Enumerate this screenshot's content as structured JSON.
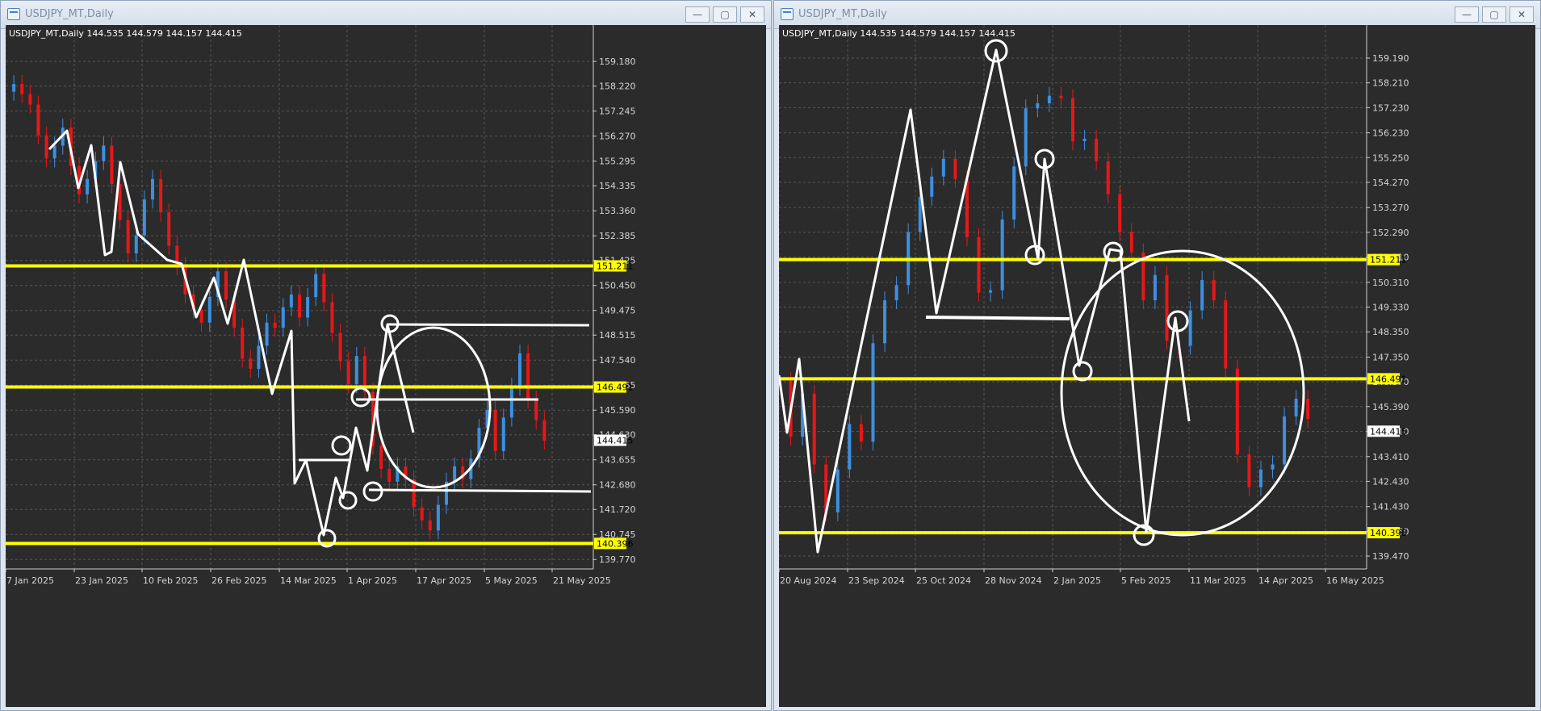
{
  "windows": [
    {
      "title": "USDJPY_MT,Daily",
      "controls": {
        "minimize": "—",
        "maximize": "▢",
        "close": "✕"
      },
      "chart_header": "USDJPY_MT,Daily  144.535 144.579 144.157 144.415"
    },
    {
      "title": "USDJPY_MT,Daily",
      "controls": {
        "minimize": "—",
        "maximize": "▢",
        "close": "✕"
      },
      "chart_header": "USDJPY_MT,Daily  144.535 144.579 144.157 144.415"
    }
  ],
  "colors": {
    "background": "#2b2b2b",
    "grid": "#555555",
    "up_candle": "#3d8fe0",
    "down_candle": "#e81717",
    "support_line": "#ffff00",
    "drawing": "#ffffff"
  },
  "chart_data": [
    {
      "type": "candlestick",
      "symbol": "USDJPY_MT",
      "timeframe": "Daily",
      "y_ticks": [
        159.18,
        158.22,
        157.245,
        156.27,
        155.295,
        154.335,
        153.36,
        152.385,
        151.425,
        150.45,
        149.475,
        148.515,
        147.54,
        146.565,
        145.59,
        144.63,
        143.655,
        142.68,
        141.72,
        140.745,
        139.77
      ],
      "x_ticks": [
        "7 Jan 2025",
        "23 Jan 2025",
        "10 Feb 2025",
        "26 Feb 2025",
        "14 Mar 2025",
        "1 Apr 2025",
        "17 Apr 2025",
        "5 May 2025",
        "21 May 2025"
      ],
      "ylim": [
        139.4,
        160.6
      ],
      "xlim": [
        "2025-01-07",
        "2025-05-31"
      ],
      "current_price": 144.415,
      "horizontal_levels": [
        151.211,
        146.491,
        140.396
      ],
      "close_series": [
        [
          "2025-01-07",
          158.0
        ],
        [
          "2025-01-09",
          158.3
        ],
        [
          "2025-01-11",
          157.9
        ],
        [
          "2025-01-13",
          157.5
        ],
        [
          "2025-01-15",
          156.3
        ],
        [
          "2025-01-17",
          155.4
        ],
        [
          "2025-01-19",
          155.9
        ],
        [
          "2025-01-21",
          156.6
        ],
        [
          "2025-01-23",
          155.1
        ],
        [
          "2025-01-25",
          154.0
        ],
        [
          "2025-01-27",
          154.6
        ],
        [
          "2025-01-29",
          155.3
        ],
        [
          "2025-01-31",
          155.9
        ],
        [
          "2025-02-02",
          154.4
        ],
        [
          "2025-02-04",
          153.0
        ],
        [
          "2025-02-06",
          151.7
        ],
        [
          "2025-02-08",
          152.4
        ],
        [
          "2025-02-10",
          153.8
        ],
        [
          "2025-02-12",
          154.6
        ],
        [
          "2025-02-14",
          153.3
        ],
        [
          "2025-02-16",
          152.0
        ],
        [
          "2025-02-18",
          151.2
        ],
        [
          "2025-02-20",
          150.1
        ],
        [
          "2025-02-22",
          149.5
        ],
        [
          "2025-02-24",
          149.0
        ],
        [
          "2025-02-26",
          150.0
        ],
        [
          "2025-02-28",
          151.0
        ],
        [
          "2025-03-02",
          149.9
        ],
        [
          "2025-03-04",
          148.8
        ],
        [
          "2025-03-06",
          147.6
        ],
        [
          "2025-03-08",
          147.2
        ],
        [
          "2025-03-10",
          148.1
        ],
        [
          "2025-03-12",
          149.0
        ],
        [
          "2025-03-14",
          148.8
        ],
        [
          "2025-03-16",
          149.6
        ],
        [
          "2025-03-18",
          150.1
        ],
        [
          "2025-03-20",
          149.2
        ],
        [
          "2025-03-22",
          150.0
        ],
        [
          "2025-03-24",
          150.9
        ],
        [
          "2025-03-26",
          149.8
        ],
        [
          "2025-03-28",
          148.6
        ],
        [
          "2025-03-30",
          147.5
        ],
        [
          "2025-04-01",
          146.6
        ],
        [
          "2025-04-03",
          147.7
        ],
        [
          "2025-04-05",
          146.3
        ],
        [
          "2025-04-07",
          144.2
        ],
        [
          "2025-04-09",
          143.3
        ],
        [
          "2025-04-11",
          142.8
        ],
        [
          "2025-04-13",
          143.4
        ],
        [
          "2025-04-15",
          142.9
        ],
        [
          "2025-04-17",
          141.8
        ],
        [
          "2025-04-19",
          141.3
        ],
        [
          "2025-04-21",
          140.9
        ],
        [
          "2025-04-23",
          141.9
        ],
        [
          "2025-04-25",
          142.8
        ],
        [
          "2025-04-27",
          143.4
        ],
        [
          "2025-04-29",
          142.9
        ],
        [
          "2025-05-01",
          143.7
        ],
        [
          "2025-05-03",
          144.9
        ],
        [
          "2025-05-05",
          145.6
        ],
        [
          "2025-05-07",
          144.0
        ],
        [
          "2025-05-09",
          145.3
        ],
        [
          "2025-05-11",
          146.5
        ],
        [
          "2025-05-13",
          147.8
        ],
        [
          "2025-05-15",
          146.0
        ],
        [
          "2025-05-17",
          145.2
        ],
        [
          "2025-05-19",
          144.4
        ]
      ]
    },
    {
      "type": "candlestick",
      "symbol": "USDJPY_MT",
      "timeframe": "Daily",
      "y_ticks": [
        159.19,
        158.21,
        157.23,
        156.23,
        155.25,
        154.27,
        153.27,
        152.29,
        151.31,
        150.31,
        149.33,
        148.35,
        147.35,
        146.37,
        145.39,
        144.41,
        143.41,
        142.43,
        141.43,
        140.45,
        139.47
      ],
      "x_ticks": [
        "20 Aug 2024",
        "23 Sep 2024",
        "25 Oct 2024",
        "28 Nov 2024",
        "2 Jan 2025",
        "5 Feb 2025",
        "11 Mar 2025",
        "14 Apr 2025",
        "16 May 2025"
      ],
      "ylim": [
        138.96,
        160.5
      ],
      "xlim": [
        "2024-08-20",
        "2025-06-16"
      ],
      "current_price": 144.415,
      "horizontal_levels": [
        151.211,
        146.491,
        140.396
      ],
      "close_series": [
        [
          "2024-08-20",
          146.4
        ],
        [
          "2024-08-26",
          144.2
        ],
        [
          "2024-09-01",
          145.9
        ],
        [
          "2024-09-07",
          143.1
        ],
        [
          "2024-09-13",
          141.2
        ],
        [
          "2024-09-19",
          142.9
        ],
        [
          "2024-09-25",
          144.7
        ],
        [
          "2024-10-01",
          144.0
        ],
        [
          "2024-10-07",
          147.9
        ],
        [
          "2024-10-13",
          149.6
        ],
        [
          "2024-10-19",
          150.2
        ],
        [
          "2024-10-25",
          152.3
        ],
        [
          "2024-10-31",
          153.7
        ],
        [
          "2024-11-06",
          154.5
        ],
        [
          "2024-11-12",
          155.2
        ],
        [
          "2024-11-18",
          154.4
        ],
        [
          "2024-11-24",
          152.1
        ],
        [
          "2024-11-30",
          149.9
        ],
        [
          "2024-12-06",
          150.0
        ],
        [
          "2024-12-12",
          152.8
        ],
        [
          "2024-12-18",
          154.9
        ],
        [
          "2024-12-24",
          157.2
        ],
        [
          "2024-12-30",
          157.4
        ],
        [
          "2025-01-05",
          157.7
        ],
        [
          "2025-01-11",
          157.6
        ],
        [
          "2025-01-17",
          155.9
        ],
        [
          "2025-01-23",
          156.0
        ],
        [
          "2025-01-29",
          155.1
        ],
        [
          "2025-02-04",
          153.8
        ],
        [
          "2025-02-10",
          152.3
        ],
        [
          "2025-02-16",
          151.5
        ],
        [
          "2025-02-22",
          149.6
        ],
        [
          "2025-02-28",
          150.6
        ],
        [
          "2025-03-06",
          148.0
        ],
        [
          "2025-03-12",
          147.8
        ],
        [
          "2025-03-18",
          149.2
        ],
        [
          "2025-03-24",
          150.4
        ],
        [
          "2025-03-30",
          149.6
        ],
        [
          "2025-04-05",
          146.9
        ],
        [
          "2025-04-11",
          143.5
        ],
        [
          "2025-04-17",
          142.2
        ],
        [
          "2025-04-23",
          142.9
        ],
        [
          "2025-04-29",
          143.1
        ],
        [
          "2025-05-05",
          145.0
        ],
        [
          "2025-05-11",
          145.7
        ],
        [
          "2025-05-17",
          144.9
        ]
      ]
    }
  ]
}
